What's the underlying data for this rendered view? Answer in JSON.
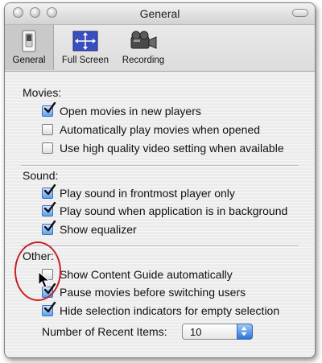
{
  "window": {
    "title": "General"
  },
  "toolbar": {
    "items": [
      {
        "label": "General",
        "icon": "switch-icon",
        "selected": true
      },
      {
        "label": "Full Screen",
        "icon": "fullscreen-arrows-icon",
        "selected": false
      },
      {
        "label": "Recording",
        "icon": "camera-icon",
        "selected": false
      }
    ]
  },
  "movies": {
    "label": "Movies:",
    "options": [
      {
        "label": "Open movies in new players",
        "checked": true
      },
      {
        "label": "Automatically play movies when opened",
        "checked": false
      },
      {
        "label": "Use high quality video setting when available",
        "checked": false
      }
    ]
  },
  "sound": {
    "label": "Sound:",
    "options": [
      {
        "label": "Play sound in frontmost player only",
        "checked": true
      },
      {
        "label": "Play sound when application is in background",
        "checked": true
      },
      {
        "label": "Show equalizer",
        "checked": true
      }
    ]
  },
  "other": {
    "label": "Other:",
    "options": [
      {
        "label": "Show Content Guide automatically",
        "checked": false
      },
      {
        "label": "Pause movies before switching users",
        "checked": true
      },
      {
        "label": "Hide selection indicators for empty selection",
        "checked": true
      }
    ],
    "recent_items": {
      "label": "Number of Recent Items:",
      "value": "10"
    }
  },
  "colors": {
    "accent": "#4a8fe6",
    "highlight_circle": "#c8202a"
  }
}
